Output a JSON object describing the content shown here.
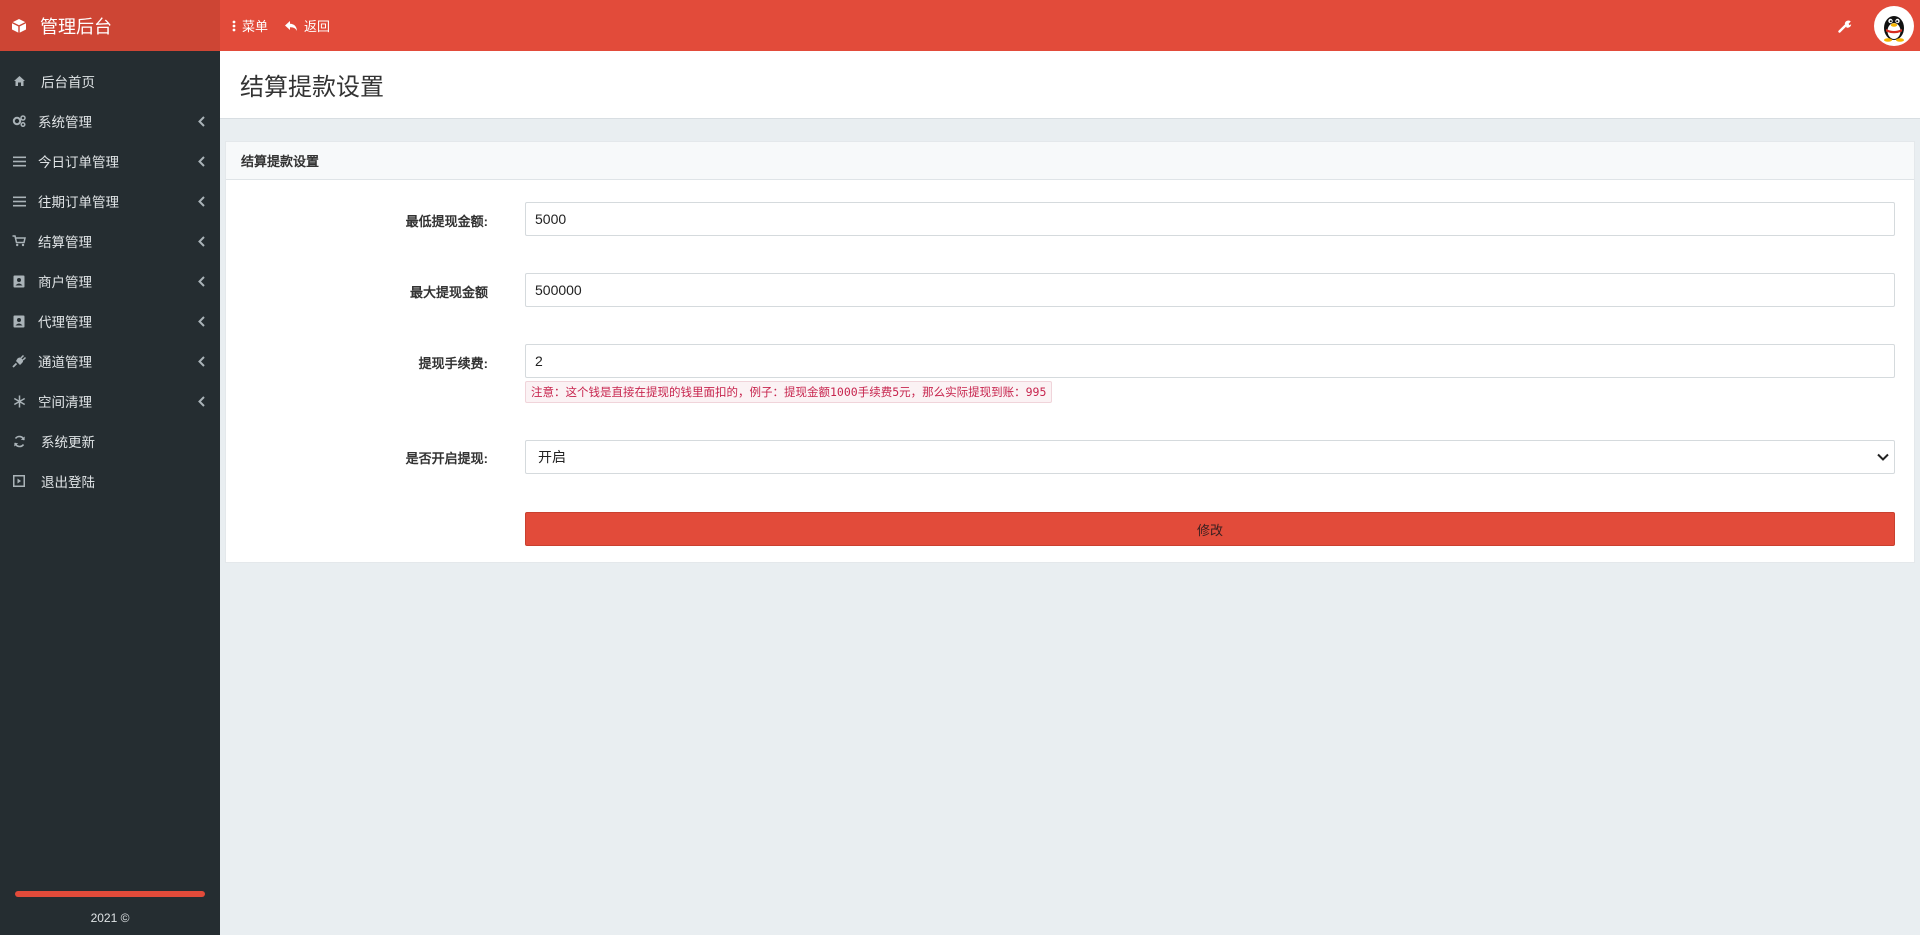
{
  "sidebar": {
    "brand_title": "管理后台",
    "brand_icon": "cube-icon",
    "items": [
      {
        "label": "后台首页",
        "icon": "home-icon"
      },
      {
        "label": "系统管理",
        "icon": "cogs-icon"
      },
      {
        "label": "今日订单管理",
        "icon": "list-icon"
      },
      {
        "label": "往期订单管理",
        "icon": "list-icon"
      },
      {
        "label": "结算管理",
        "icon": "cart-icon"
      },
      {
        "label": "商户管理",
        "icon": "contact-icon"
      },
      {
        "label": "代理管理",
        "icon": "contact-icon"
      },
      {
        "label": "通道管理",
        "icon": "plug-icon"
      },
      {
        "label": "空间清理",
        "icon": "snowflake-icon"
      },
      {
        "label": "系统更新",
        "icon": "refresh-icon"
      },
      {
        "label": "退出登陆",
        "icon": "logout-icon"
      }
    ],
    "footer": "2021 ©"
  },
  "topbar": {
    "menu_label": "菜单",
    "back_label": "返回"
  },
  "page": {
    "title": "结算提款设置"
  },
  "card": {
    "header": "结算提款设置",
    "min_label": "最低提现金额:",
    "min_value": "5000",
    "max_label": "最大提现金额",
    "max_value": "500000",
    "fee_label": "提现手续费:",
    "fee_value": "2",
    "fee_note": "注意：这个钱是直接在提现的钱里面扣的，例子：提现金额1000手续费5元，那么实际提现到账：995",
    "enable_label": "是否开启提现:",
    "enable_selected": "开启",
    "submit_label": "修改"
  },
  "colors": {
    "brand": "#e24b3a",
    "brand_dark": "#cd4534",
    "sidebar_bg": "#252d31",
    "content_bg": "#e9eef1"
  }
}
